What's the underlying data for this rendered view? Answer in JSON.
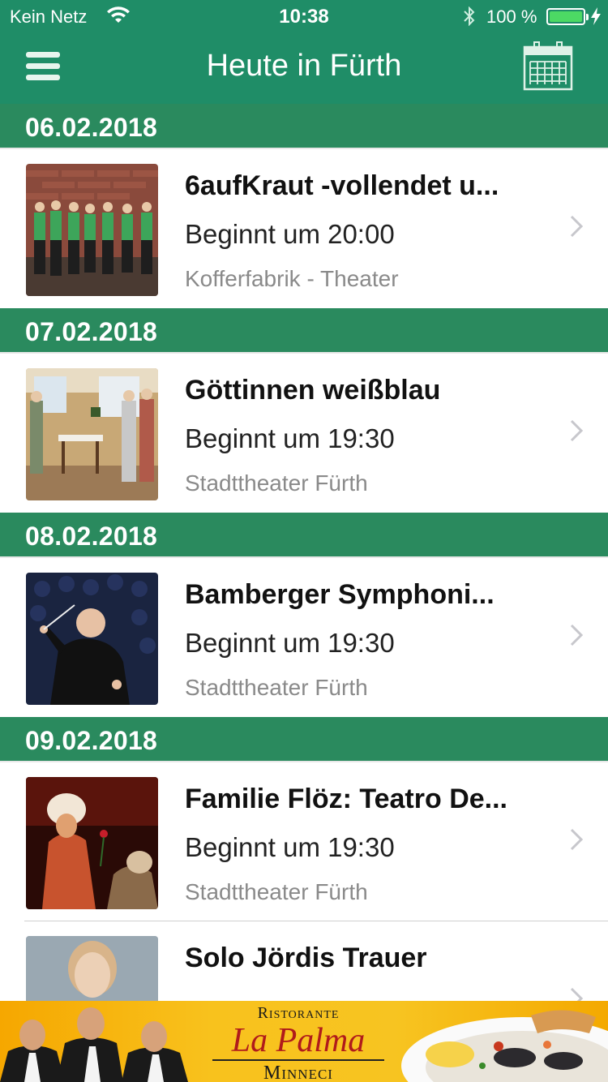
{
  "status_bar": {
    "carrier": "Kein Netz",
    "time": "10:38",
    "battery_percent": "100 %",
    "battery_level": 1.0,
    "icons": [
      "wifi-icon",
      "bluetooth-icon",
      "battery-icon",
      "charging-bolt-icon"
    ]
  },
  "nav": {
    "title": "Heute in Fürth",
    "left_icon": "hamburger-menu-icon",
    "right_icon": "calendar-icon"
  },
  "colors": {
    "primary_green": "#1f8d67",
    "section_green": "#2a8a5e",
    "battery_green": "#4cd964",
    "ad_yellow": "#f8c21d",
    "ad_red": "#b01b1b"
  },
  "sections": [
    {
      "date": "06.02.2018",
      "events": [
        {
          "title": "6aufKraut -vollendet u...",
          "time": "Beginnt um 20:00",
          "venue": "Kofferfabrik - Theater",
          "image": "performers-in-green-shirts-photo"
        }
      ]
    },
    {
      "date": "07.02.2018",
      "events": [
        {
          "title": "Göttinnen weißblau",
          "time": "Beginnt um 19:30",
          "venue": "Stadttheater Fürth",
          "image": "stage-kitchen-scene-photo"
        }
      ]
    },
    {
      "date": "08.02.2018",
      "events": [
        {
          "title": "Bamberger Symphoni...",
          "time": "Beginnt um 19:30",
          "venue": "Stadttheater Fürth",
          "image": "conductor-photo"
        }
      ]
    },
    {
      "date": "09.02.2018",
      "events": [
        {
          "title": "Familie Flöz: Teatro De...",
          "time": "Beginnt um 19:30",
          "venue": "Stadttheater Fürth",
          "image": "masked-baroque-figures-photo"
        },
        {
          "title": "Solo Jördis Trauer",
          "time": "",
          "venue": "",
          "image": "portrait-woman-photo"
        }
      ]
    }
  ],
  "ad": {
    "line1": "Ristorante",
    "line2": "La Palma",
    "line3": "Minneci",
    "images": [
      "three-waiters-photo",
      "seafood-plate-photo"
    ]
  }
}
